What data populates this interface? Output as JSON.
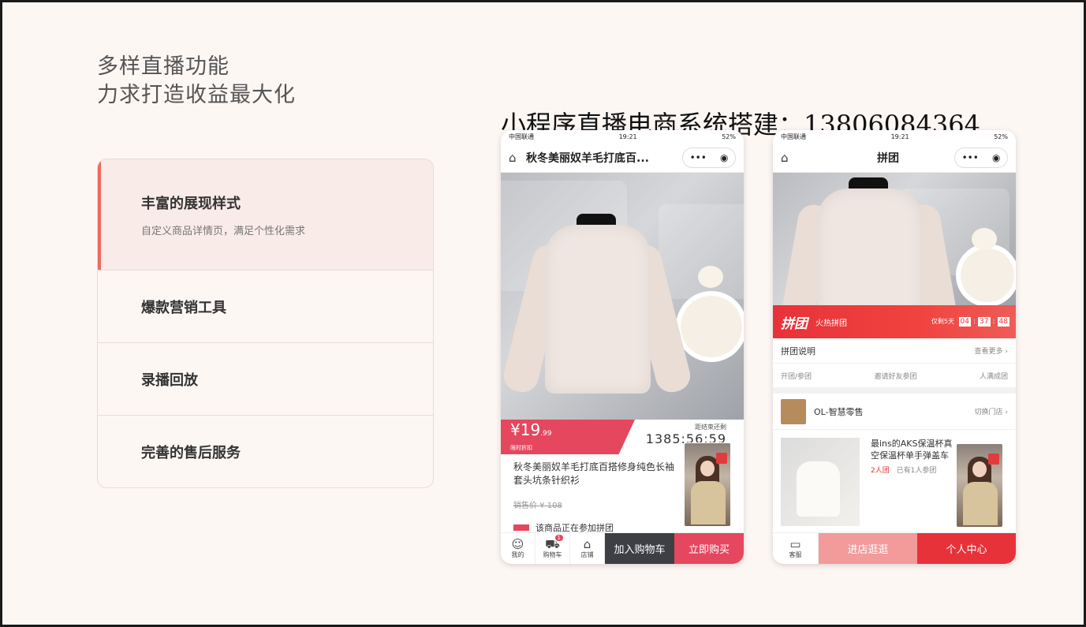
{
  "headline": {
    "line1": "多样直播功能",
    "line2": "力求打造收益最大化"
  },
  "features": [
    {
      "title": "丰富的展现样式",
      "desc": "自定义商品详情页，满足个性化需求",
      "active": true
    },
    {
      "title": "爆款营销工具",
      "desc": "",
      "active": false
    },
    {
      "title": "录播回放",
      "desc": "",
      "active": false
    },
    {
      "title": "完善的售后服务",
      "desc": "",
      "active": false
    }
  ],
  "banner": "小程序直播电商系统搭建：13806084364",
  "colors": {
    "accent": "#ee6a5d",
    "price_red": "#e5475f",
    "pintuan_red": "#e8323a",
    "dark_btn": "#3d3f45",
    "pink_btn": "#f39a9a"
  },
  "phone1": {
    "status": {
      "carrier": "中国联通",
      "time": "19:21",
      "battery": "52%"
    },
    "title": "秋冬美丽奴羊毛打底百...",
    "capsule_dots": "•••",
    "capsule_icon": "◉",
    "price": {
      "symbol": "¥",
      "integer": "19",
      "decimal": ".99",
      "tag": "限时折扣"
    },
    "countdown": {
      "label": "距结束还剩",
      "value": "1385:56:59"
    },
    "product_name": "秋冬美丽奴羊毛打底百搭修身纯色长袖套头坑条针织衫",
    "old_price": "销售价 ¥ 108",
    "group_tip": "该商品正在参加拼团",
    "bottom": {
      "icons": [
        {
          "name": "我的",
          "glyph": "☺"
        },
        {
          "name": "购物车",
          "glyph": "⛟"
        },
        {
          "name": "店铺",
          "glyph": "⌂"
        }
      ],
      "cart_badge": "1",
      "add_cart": "加入购物车",
      "buy_now": "立即购买"
    }
  },
  "phone2": {
    "status": {
      "carrier": "中国联通",
      "time": "19:21",
      "battery": "52%"
    },
    "title": "拼团",
    "capsule_dots": "•••",
    "capsule_icon": "◉",
    "pintuan": {
      "logo": "拼团",
      "text": "火热拼团",
      "remain": "仅剩5天",
      "h": "04",
      "m": "37",
      "s": "48"
    },
    "rule": {
      "label": "拼团说明",
      "more": "查看更多 ›"
    },
    "steps": [
      "开团/参团",
      "邀请好友参团",
      "人满成团"
    ],
    "shop": {
      "name": "OL-智慧零售",
      "switch": "切换门店 ›"
    },
    "goods": {
      "name": "最ins的AKS保温杯真空保温杯单手弹盖车",
      "tag": "2人团",
      "joined": "已有1人参团"
    },
    "bottom": {
      "service": "客服",
      "enter_shop": "进店逛逛",
      "user_center": "个人中心"
    }
  }
}
